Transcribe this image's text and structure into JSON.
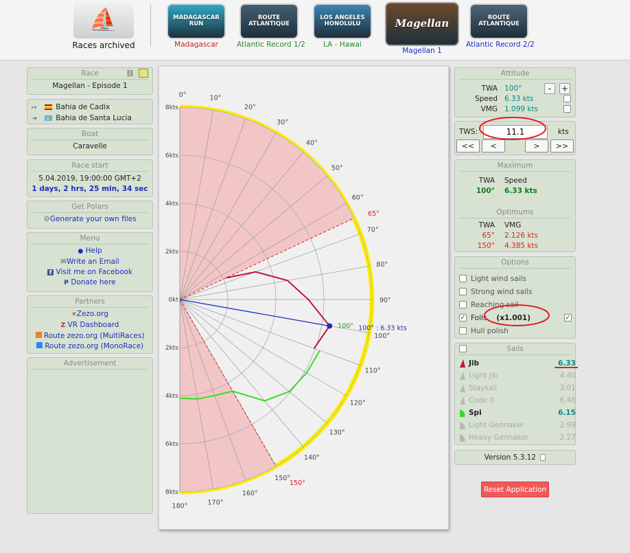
{
  "topbar": {
    "archived_label": "Races archived",
    "races": [
      {
        "label": "Madagascar",
        "color": "#c2262a",
        "thumb": "MADAGASCAR RUN",
        "bg": "#2fa8c6"
      },
      {
        "label": "Atlantic Record 1/2",
        "color": "#2a8a2a",
        "thumb": "ROUTE ATLANTIQUE",
        "bg": "#436072"
      },
      {
        "label": "LA - Hawai",
        "color": "#2a8a2a",
        "thumb": "LOS ANGELES HONOLULU",
        "bg": "#3b86b5"
      },
      {
        "label": "Magellan 1",
        "color": "#1b2fc0",
        "thumb": "Magellan",
        "bg": "#6b4a2b"
      },
      {
        "label": "Atlantic Record 2/2",
        "color": "#1b2fc0",
        "thumb": "ROUTE ATLANTIQUE",
        "bg": "#4d6578"
      }
    ]
  },
  "left": {
    "race_header": "Race",
    "race_name": "Magellan - Episode 1",
    "from": "Bahia de Cadix",
    "to": "Bahia de Santa Lucia",
    "boat_header": "Boat",
    "boat_name": "Caravelle",
    "start_header": "Race start",
    "start_date": "5.04.2019, 19:00:00 GMT+2",
    "elapsed": "1 days, 2 hrs, 25 min, 34 sec",
    "polars_header": "Get Polars",
    "polars_link": "Generate your own files",
    "menu_header": "Menu",
    "menu": [
      "Help",
      "Write an Email",
      "Visit me on Facebook",
      "Donate here"
    ],
    "partners_header": "Partners",
    "partners": [
      "Zezo.org",
      "VR Dashboard",
      "Route zezo.org (MultiRaces)",
      "Route zezo.org (MonoRace)"
    ],
    "ad_header": "Advertisement"
  },
  "chart_data": {
    "type": "polar-line",
    "r_axis_ticks": [
      "8kts",
      "6kts",
      "4kts",
      "2kts",
      "0kt",
      "2kts",
      "4kts",
      "6kts",
      "8kts"
    ],
    "angle_ticks": [
      "0°",
      "10°",
      "20°",
      "30°",
      "40°",
      "50°",
      "60°",
      "70°",
      "80°",
      "90°",
      "100°",
      "110°",
      "120°",
      "130°",
      "140°",
      "150°",
      "160°",
      "170°",
      "180°"
    ],
    "r_max": 8,
    "upwind_limit_label": "65°",
    "downwind_limit_label": "150°",
    "upwind_limit": 65,
    "downwind_limit": 150,
    "highlight_marker_label": "100°",
    "highlight_label": "100° : 6.33 kts",
    "highlight_twa": 100,
    "highlight_speed": 6.33,
    "series": [
      {
        "name": "Jib",
        "color": "#c0143c",
        "points": [
          [
            65,
            2.13
          ],
          [
            70,
            3.36
          ],
          [
            80,
            4.55
          ],
          [
            90,
            5.35
          ],
          [
            100,
            6.33
          ],
          [
            110,
            5.95
          ]
        ]
      },
      {
        "name": "Spi",
        "color": "#33dd22",
        "points": [
          [
            110,
            6.2
          ],
          [
            120,
            6.1
          ],
          [
            130,
            5.95
          ],
          [
            140,
            5.5
          ],
          [
            150,
            4.4
          ],
          [
            160,
            4.25
          ],
          [
            170,
            4.2
          ],
          [
            180,
            4.1
          ]
        ]
      }
    ]
  },
  "attitude": {
    "header": "Attitude",
    "twa_label": "TWA",
    "twa_value": "100°",
    "speed_label": "Speed",
    "speed_value": "6.33 kts",
    "vmg_label": "VMG",
    "vmg_value": "1.099 kts",
    "minus": "-",
    "plus": "+"
  },
  "tws": {
    "label": "TWS:",
    "value": "11.1",
    "unit": "kts",
    "nav": [
      "<<",
      "<",
      ">",
      ">>"
    ]
  },
  "maximum": {
    "header": "Maximum",
    "twa_label": "TWA",
    "speed_label": "Speed",
    "twa": "100°",
    "speed": "6.33 kts"
  },
  "optimums": {
    "header": "Optimums",
    "twa_label": "TWA",
    "vmg_label": "VMG",
    "rows": [
      {
        "twa": "65°",
        "vmg": "2.126 kts"
      },
      {
        "twa": "150°",
        "vmg": "4.385 kts"
      }
    ]
  },
  "options": {
    "header": "Options",
    "items": [
      {
        "label": "Light wind sails",
        "checked": false
      },
      {
        "label": "Strong wind sails",
        "checked": false
      },
      {
        "label": "Reaching sail",
        "checked": false
      },
      {
        "label": "Foils",
        "checked": true
      },
      {
        "label": "Hull polish",
        "checked": false
      }
    ],
    "foils_factor": "(x1.001)"
  },
  "sails": {
    "header": "Sails",
    "items": [
      {
        "name": "Jib",
        "value": "6.33",
        "active": true,
        "icon": "jib-sail-icon",
        "color": "#c0143c"
      },
      {
        "name": "Light jib",
        "value": "4.40",
        "active": false,
        "icon": "light-jib-sail-icon",
        "color": "#b8b8b8"
      },
      {
        "name": "Staysail",
        "value": "3.01",
        "active": false,
        "icon": "staysail-icon",
        "color": "#b8b8b8"
      },
      {
        "name": "Code 0",
        "value": "6.46",
        "active": false,
        "icon": "code0-sail-icon",
        "color": "#b8b8b8"
      },
      {
        "name": "Spi",
        "value": "6.15",
        "active": true,
        "icon": "spi-sail-icon",
        "color": "#33dd22"
      },
      {
        "name": "Light Gennaker",
        "value": "2.99",
        "active": false,
        "icon": "light-gennaker-sail-icon",
        "color": "#b8b8b8"
      },
      {
        "name": "Heavy Gennaker",
        "value": "2.27",
        "active": false,
        "icon": "heavy-gennaker-sail-icon",
        "color": "#b8b8b8"
      }
    ]
  },
  "version": "Version 5.3.12",
  "reset_label": "Reset Application",
  "colors": {
    "panel": "#d7e2d2",
    "link": "#1b2fc0",
    "accent_red": "#e84a4a",
    "annotation": "#e02020"
  }
}
